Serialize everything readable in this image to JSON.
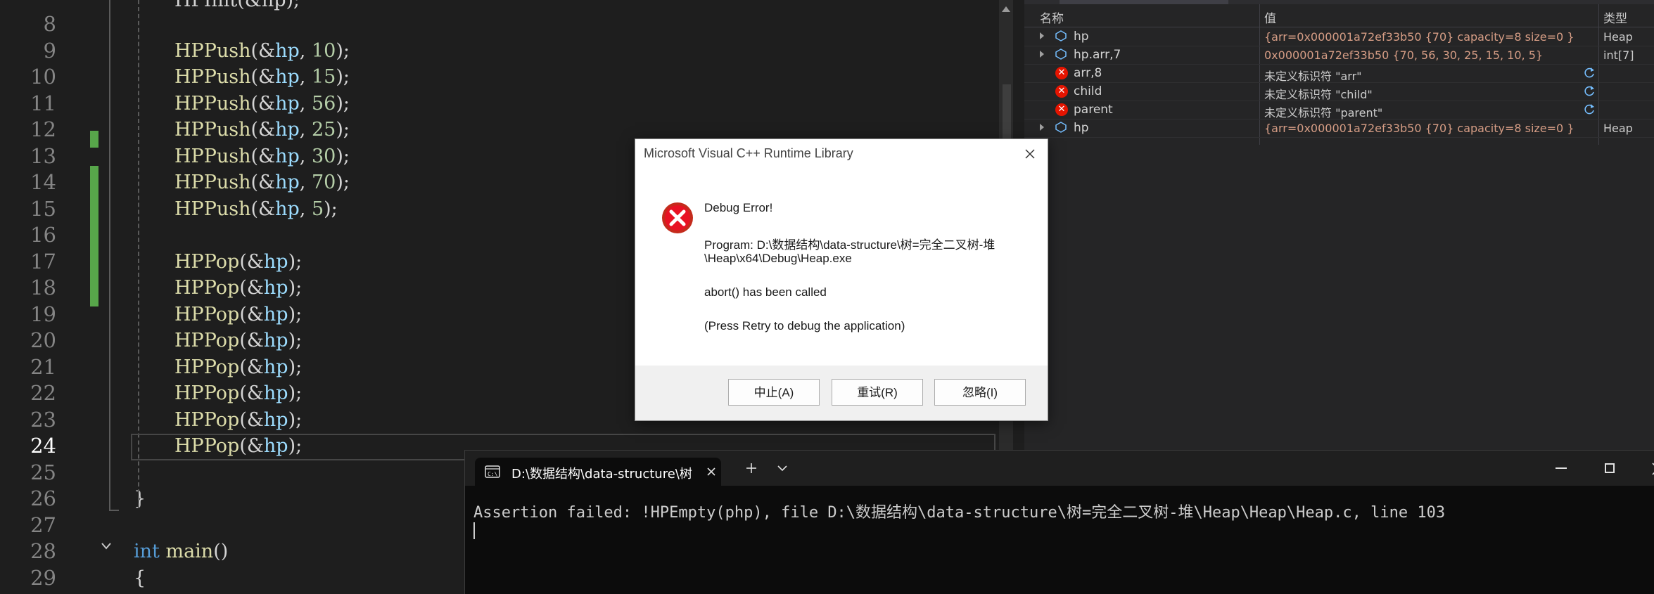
{
  "editor": {
    "lines": [
      {
        "num": "8",
        "code": []
      },
      {
        "num": "9",
        "code": [
          {
            "t": "HPPush",
            "c": "fn"
          },
          {
            "t": "(&",
            "c": "op"
          },
          {
            "t": "hp",
            "c": "var"
          },
          {
            "t": ", ",
            "c": "op"
          },
          {
            "t": "10",
            "c": "num"
          },
          {
            "t": ");",
            "c": "op"
          }
        ]
      },
      {
        "num": "10",
        "code": [
          {
            "t": "HPPush",
            "c": "fn"
          },
          {
            "t": "(&",
            "c": "op"
          },
          {
            "t": "hp",
            "c": "var"
          },
          {
            "t": ", ",
            "c": "op"
          },
          {
            "t": "15",
            "c": "num"
          },
          {
            "t": ");",
            "c": "op"
          }
        ]
      },
      {
        "num": "11",
        "code": [
          {
            "t": "HPPush",
            "c": "fn"
          },
          {
            "t": "(&",
            "c": "op"
          },
          {
            "t": "hp",
            "c": "var"
          },
          {
            "t": ", ",
            "c": "op"
          },
          {
            "t": "56",
            "c": "num"
          },
          {
            "t": ");",
            "c": "op"
          }
        ]
      },
      {
        "num": "12",
        "code": [
          {
            "t": "HPPush",
            "c": "fn"
          },
          {
            "t": "(&",
            "c": "op"
          },
          {
            "t": "hp",
            "c": "var"
          },
          {
            "t": ", ",
            "c": "op"
          },
          {
            "t": "25",
            "c": "num"
          },
          {
            "t": ");",
            "c": "op"
          }
        ]
      },
      {
        "num": "13",
        "code": [
          {
            "t": "HPPush",
            "c": "fn"
          },
          {
            "t": "(&",
            "c": "op"
          },
          {
            "t": "hp",
            "c": "var"
          },
          {
            "t": ", ",
            "c": "op"
          },
          {
            "t": "30",
            "c": "num"
          },
          {
            "t": ");",
            "c": "op"
          }
        ]
      },
      {
        "num": "14",
        "code": [
          {
            "t": "HPPush",
            "c": "fn"
          },
          {
            "t": "(&",
            "c": "op"
          },
          {
            "t": "hp",
            "c": "var"
          },
          {
            "t": ", ",
            "c": "op"
          },
          {
            "t": "70",
            "c": "num"
          },
          {
            "t": ");",
            "c": "op"
          }
        ]
      },
      {
        "num": "15",
        "code": [
          {
            "t": "HPPush",
            "c": "fn"
          },
          {
            "t": "(&",
            "c": "op"
          },
          {
            "t": "hp",
            "c": "var"
          },
          {
            "t": ", ",
            "c": "op"
          },
          {
            "t": "5",
            "c": "num"
          },
          {
            "t": ");",
            "c": "op"
          }
        ]
      },
      {
        "num": "16",
        "code": []
      },
      {
        "num": "17",
        "code": [
          {
            "t": "HPPop",
            "c": "fn"
          },
          {
            "t": "(&",
            "c": "op"
          },
          {
            "t": "hp",
            "c": "var"
          },
          {
            "t": ");",
            "c": "op"
          }
        ]
      },
      {
        "num": "18",
        "code": [
          {
            "t": "HPPop",
            "c": "fn"
          },
          {
            "t": "(&",
            "c": "op"
          },
          {
            "t": "hp",
            "c": "var"
          },
          {
            "t": ");",
            "c": "op"
          }
        ]
      },
      {
        "num": "19",
        "code": [
          {
            "t": "HPPop",
            "c": "fn"
          },
          {
            "t": "(&",
            "c": "op"
          },
          {
            "t": "hp",
            "c": "var"
          },
          {
            "t": ");",
            "c": "op"
          }
        ]
      },
      {
        "num": "20",
        "code": [
          {
            "t": "HPPop",
            "c": "fn"
          },
          {
            "t": "(&",
            "c": "op"
          },
          {
            "t": "hp",
            "c": "var"
          },
          {
            "t": ");",
            "c": "op"
          }
        ]
      },
      {
        "num": "21",
        "code": [
          {
            "t": "HPPop",
            "c": "fn"
          },
          {
            "t": "(&",
            "c": "op"
          },
          {
            "t": "hp",
            "c": "var"
          },
          {
            "t": ");",
            "c": "op"
          }
        ]
      },
      {
        "num": "22",
        "code": [
          {
            "t": "HPPop",
            "c": "fn"
          },
          {
            "t": "(&",
            "c": "op"
          },
          {
            "t": "hp",
            "c": "var"
          },
          {
            "t": ");",
            "c": "op"
          }
        ]
      },
      {
        "num": "23",
        "code": [
          {
            "t": "HPPop",
            "c": "fn"
          },
          {
            "t": "(&",
            "c": "op"
          },
          {
            "t": "hp",
            "c": "var"
          },
          {
            "t": ");",
            "c": "op"
          }
        ]
      },
      {
        "num": "24",
        "code": [
          {
            "t": "HPPop",
            "c": "fn"
          },
          {
            "t": "(&",
            "c": "op"
          },
          {
            "t": "hp",
            "c": "var"
          },
          {
            "t": ");",
            "c": "op"
          }
        ]
      },
      {
        "num": "25",
        "code": []
      },
      {
        "num": "26",
        "code": [
          {
            "t": "}",
            "c": "op"
          }
        ]
      },
      {
        "num": "27",
        "code": []
      },
      {
        "num": "28",
        "code": [
          {
            "t": "int",
            "c": "kw"
          },
          {
            "t": " ",
            "c": "op"
          },
          {
            "t": "main",
            "c": "fn"
          },
          {
            "t": "()",
            "c": "op"
          }
        ]
      },
      {
        "num": "29",
        "code": [
          {
            "t": "{",
            "c": "op"
          }
        ]
      }
    ],
    "top_partial": "HPInit(&hp);",
    "current_line": "24",
    "changed_lines": [
      "15",
      "17-24"
    ]
  },
  "watch": {
    "col_name": "名称",
    "col_value": "值",
    "col_type": "类型",
    "rows": [
      {
        "name": "hp",
        "value": "{arr=0x000001a72ef33b50 {70} capacity=8 size=0 }",
        "type": "Heap",
        "expand": true,
        "icon": "object-icon",
        "style": "red"
      },
      {
        "name": "hp.arr,7",
        "value": "0x000001a72ef33b50 {70, 56, 30, 25, 15, 10, 5}",
        "type": "int[7]",
        "expand": true,
        "icon": "object-icon",
        "style": "red"
      },
      {
        "name": "arr,8",
        "value": "未定义标识符 \"arr\"",
        "type": "",
        "expand": false,
        "icon": "error-icon",
        "style": "plain",
        "refresh": true
      },
      {
        "name": "child",
        "value": "未定义标识符 \"child\"",
        "type": "",
        "expand": false,
        "icon": "error-icon",
        "style": "plain",
        "refresh": true
      },
      {
        "name": "parent",
        "value": "未定义标识符 \"parent\"",
        "type": "",
        "expand": false,
        "icon": "error-icon",
        "style": "plain",
        "refresh": true
      },
      {
        "name": "hp",
        "value": "{arr=0x000001a72ef33b50 {70} capacity=8 size=0 }",
        "type": "Heap",
        "expand": true,
        "icon": "object-icon",
        "style": "red"
      }
    ]
  },
  "dialog": {
    "title": "Microsoft Visual C++ Runtime Library",
    "heading": "Debug Error!",
    "program_line1": "Program: D:\\数据结构\\data-structure\\树=完全二叉树-堆",
    "program_line2": "\\Heap\\x64\\Debug\\Heap.exe",
    "message": "abort() has been called",
    "hint": "(Press Retry to debug the application)",
    "btn_abort": "中止(A)",
    "btn_retry": "重试(R)",
    "btn_ignore": "忽略(I)"
  },
  "terminal": {
    "tab_title": "D:\\数据结构\\data-structure\\树",
    "output": "Assertion failed: !HPEmpty(php), file D:\\数据结构\\data-structure\\树=完全二叉树-堆\\Heap\\Heap\\Heap.c, line 103"
  },
  "colors": {
    "editor_bg": "#1e1e1e",
    "function": "#dcdcaa",
    "variable": "#9cdcfe",
    "keyword": "#569cd6",
    "number": "#b5cea8",
    "change_bar": "#57a64a",
    "error": "#e51400"
  }
}
